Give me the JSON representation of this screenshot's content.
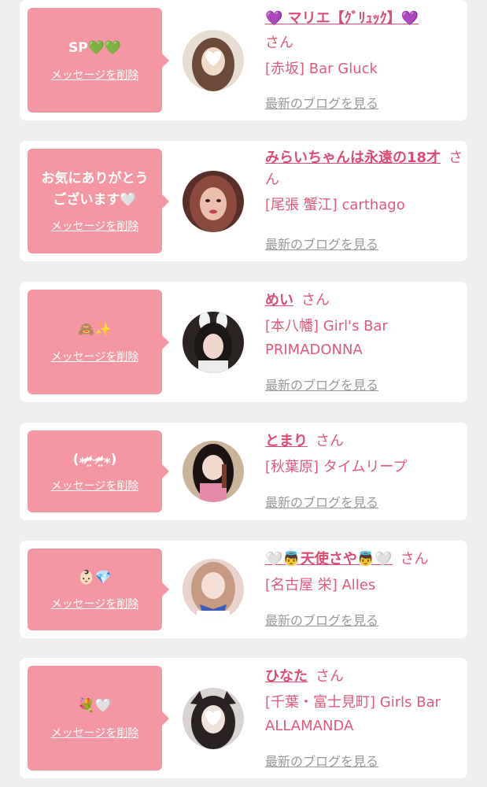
{
  "cards": [
    {
      "message": "SP💚💚",
      "delete_label": "メッセージを削除",
      "name": "💜 マリエ【ｸﾞﾘｭｯｸ】💜",
      "honorific": "さん",
      "shop": "[赤坂] Bar Gluck",
      "blog_label": "最新のブログを見る"
    },
    {
      "message": "お気にありがとう\nございます🤍",
      "delete_label": "メッセージを削除",
      "name": "みらいちゃんは永遠の18才",
      "honorific": "さん",
      "shop": "[尾張 蟹江] carthago",
      "blog_label": "最新のブログを見る"
    },
    {
      "message": "🙈✨",
      "delete_label": "メッセージを削除",
      "name": "めい",
      "honorific": "さん",
      "shop": "[本八幡] Girl's Bar PRIMADONNA",
      "blog_label": "最新のブログを見る"
    },
    {
      "message": "(⁎ᵕ̴̶̷̤ ᵕ̴̶̷̤⁎)",
      "delete_label": "メッセージを削除",
      "name": "とまり",
      "honorific": "さん",
      "shop": "[秋葉原] タイムリープ",
      "blog_label": "最新のブログを見る"
    },
    {
      "message": "👶🏻💎",
      "delete_label": "メッセージを削除",
      "name": "🤍👼天使さや👼🤍",
      "honorific": "さん",
      "shop": "[名古屋 栄] Alles",
      "blog_label": "最新のブログを見る"
    },
    {
      "message": "💐🤍",
      "delete_label": "メッセージを削除",
      "name": "ひなた",
      "honorific": "さん",
      "shop": "[千葉・富士見町] Girls Bar ALLAMANDA",
      "blog_label": "最新のブログを見る"
    }
  ],
  "colors": {
    "bubble": "#f597a3",
    "name": "#dd4b70",
    "text": "#e05a78",
    "link_gray": "#999999",
    "background": "#f0edef"
  }
}
